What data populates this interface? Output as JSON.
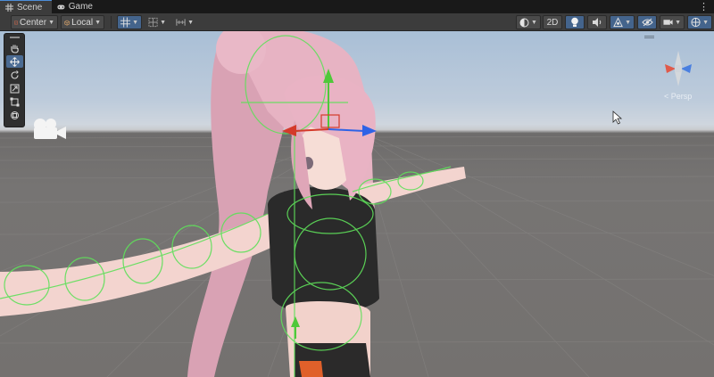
{
  "tabs": [
    {
      "label": "Scene",
      "icon": "grid-icon",
      "active": true
    },
    {
      "label": "Game",
      "icon": "gamepad-icon",
      "active": false
    }
  ],
  "toolbar": {
    "pivot_label": "Center",
    "space_label": "Local",
    "view_2d_label": "2D"
  },
  "gizmo": {
    "projection_label": "< Persp"
  },
  "colors": {
    "accent": "#4c8ed8",
    "active_button": "#44648c",
    "bone_green": "#5fe05a",
    "axis_x": "#d43a2a",
    "axis_y": "#4fc83a",
    "axis_z": "#2f63e6"
  }
}
